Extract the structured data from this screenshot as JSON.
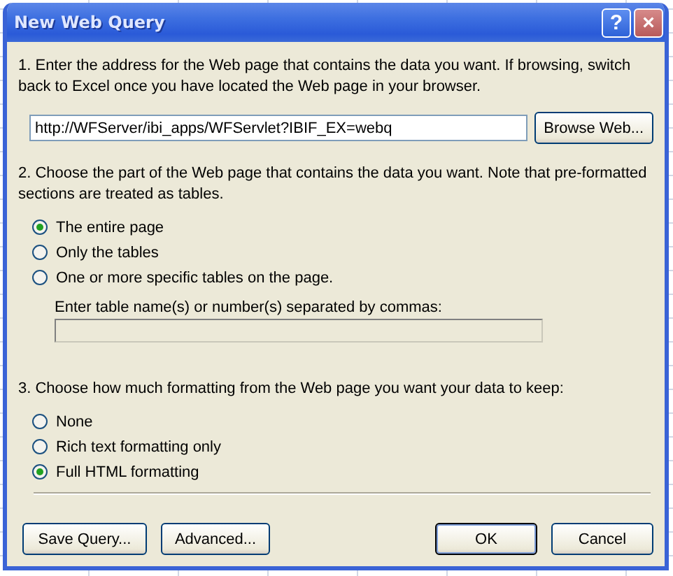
{
  "window": {
    "title": "New Web Query",
    "help_button": "?",
    "close_button": "×"
  },
  "address": {
    "instruction": "1. Enter the address for the Web page that contains the data you want.  If browsing, switch back to Excel once you have located the Web page in your browser.",
    "value": "http://WFServer/ibi_apps/WFServlet?IBIF_EX=webq",
    "browse_button": "Browse Web..."
  },
  "part": {
    "instruction": "2. Choose the part of the Web page that contains the data you want.  Note that pre-formatted sections are treated as tables.",
    "options": [
      {
        "label": "The entire page",
        "selected": true
      },
      {
        "label": "Only the tables",
        "selected": false
      },
      {
        "label": "One or more specific tables on the page.",
        "selected": false
      }
    ],
    "tables_label": "Enter table name(s) or number(s) separated by commas:",
    "tables_field_disabled": true
  },
  "formatting": {
    "instruction": "3. Choose how much formatting from the Web page you want your data to keep:",
    "options": [
      {
        "label": "None",
        "selected": false
      },
      {
        "label": "Rich text formatting only",
        "selected": false
      },
      {
        "label": "Full HTML formatting",
        "selected": true
      }
    ]
  },
  "buttons": [
    {
      "label": "Save Query...",
      "default": false
    },
    {
      "label": "Advanced...",
      "default": false
    },
    {
      "label": "OK",
      "default": true
    },
    {
      "label": "Cancel",
      "default": false
    }
  ]
}
